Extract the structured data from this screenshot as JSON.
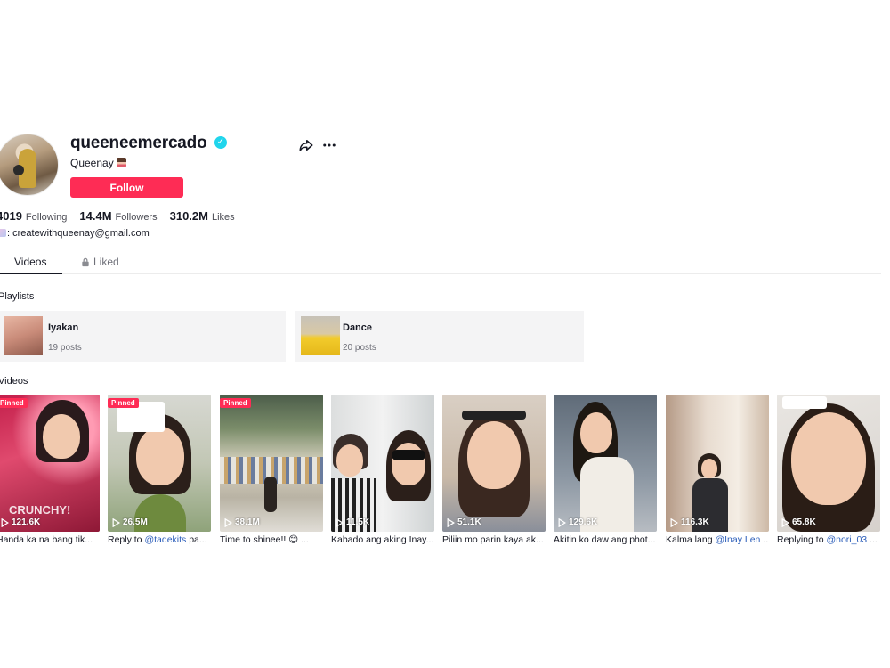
{
  "profile": {
    "username": "queeneemercado",
    "nickname": "Queenay",
    "follow_label": "Follow",
    "bio_email": ": createwithqueenay@gmail.com"
  },
  "stats": [
    {
      "value": "4019",
      "label": "Following"
    },
    {
      "value": "14.4M",
      "label": "Followers"
    },
    {
      "value": "310.2M",
      "label": "Likes"
    }
  ],
  "tabs": {
    "videos": "Videos",
    "liked": "Liked"
  },
  "playlists_title": "Playlists",
  "playlists": [
    {
      "name": "Iyakan",
      "count": "19 posts"
    },
    {
      "name": "Dance",
      "count": "20 posts"
    }
  ],
  "videos_title": "Videos",
  "videos": [
    {
      "pinned": "Pinned",
      "views": "121.6K",
      "caption": "Handa ka na bang tik..."
    },
    {
      "pinned": "Pinned",
      "views": "26.5M",
      "caption_prefix": "Reply to ",
      "mention": "@tadekits",
      "caption_suffix": " pa..."
    },
    {
      "pinned": "Pinned",
      "views": "38.1M",
      "caption": "Time to shinee!! 😊 ..."
    },
    {
      "views": "11.5K",
      "caption": "Kabado ang aking Inay..."
    },
    {
      "views": "51.1K",
      "caption": "Piliin mo parin kaya ak..."
    },
    {
      "views": "129.6K",
      "caption": "Akitin ko daw ang phot..."
    },
    {
      "views": "116.3K",
      "caption_prefix": "Kalma lang ",
      "mention": "@Inay Len",
      "caption_suffix": " ..."
    },
    {
      "views": "65.8K",
      "caption_prefix": "Replying to ",
      "mention": "@nori_03",
      "caption_suffix": " ..."
    }
  ],
  "overlay_texts": {
    "crunchy": "CRUNCHY!"
  },
  "colors": {
    "accent": "#fe2c55",
    "verified": "#20d5ec",
    "mention": "#2b5db9"
  },
  "icons": [
    "verified-badge-icon",
    "share-icon",
    "more-icon",
    "lock-icon",
    "play-icon"
  ]
}
